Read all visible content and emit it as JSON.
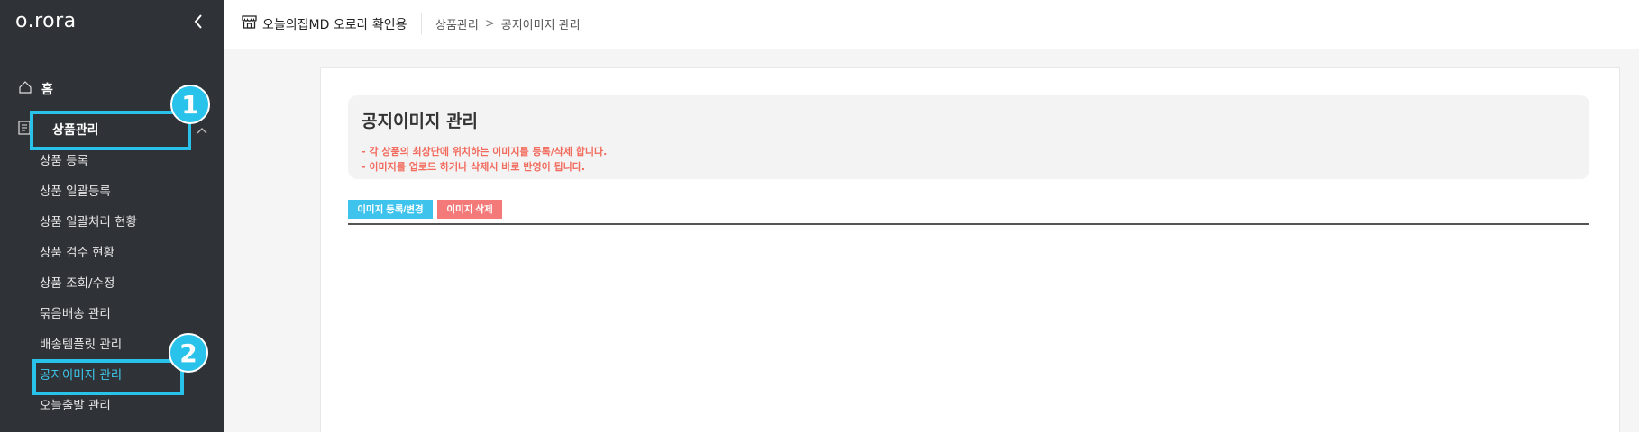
{
  "sidebar": {
    "logo": "o.rora",
    "home_label": "홈",
    "group_label": "상품관리",
    "items": [
      {
        "label": "상품 등록"
      },
      {
        "label": "상품 일괄등록"
      },
      {
        "label": "상품 일괄처리 현황"
      },
      {
        "label": "상품 검수 현황"
      },
      {
        "label": "상품 조회/수정"
      },
      {
        "label": "묶음배송 관리"
      },
      {
        "label": "배송템플릿 관리"
      },
      {
        "label": "공지이미지 관리"
      },
      {
        "label": "오늘출발 관리"
      }
    ],
    "active_index": 7
  },
  "annotations": {
    "badge1": "1",
    "badge2": "2",
    "color": "#29c2ea"
  },
  "header": {
    "shop_name": "오늘의집MD 오로라 확인용",
    "breadcrumb": [
      "상품관리",
      "공지이미지 관리"
    ],
    "breadcrumb_sep": ">"
  },
  "main": {
    "title": "공지이미지 관리",
    "notes": [
      "- 각 상품의 최상단에 위치하는 이미지를 등록/삭제 합니다.",
      "- 이미지를 업로드 하거나 삭제시 바로 반영이 됩니다."
    ],
    "register_button": "이미지 등록/변경",
    "delete_button": "이미지 삭제"
  },
  "icons": {
    "collapse": "chevron-left-icon",
    "home": "home-icon",
    "group": "document-icon",
    "group_toggle": "chevron-up-icon",
    "shop": "store-icon"
  }
}
